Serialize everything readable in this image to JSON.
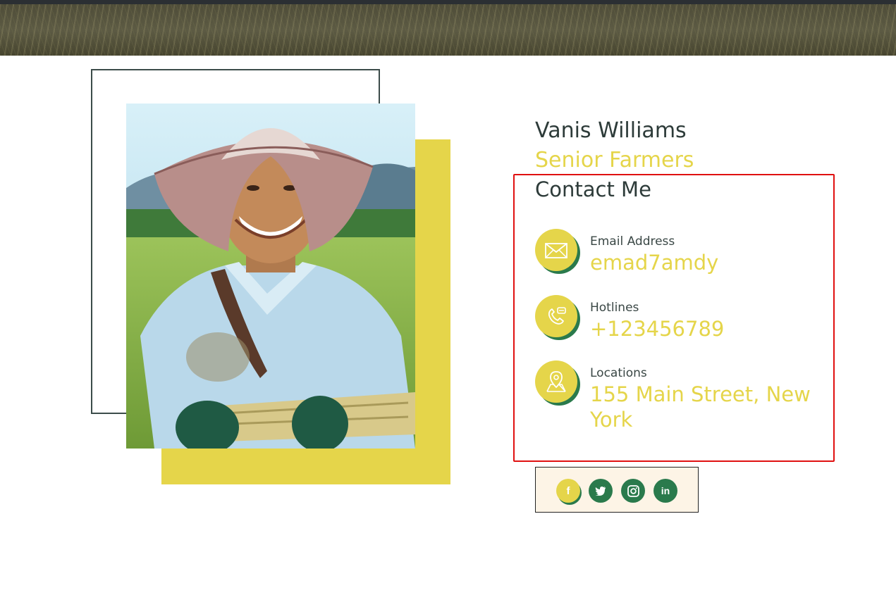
{
  "profile": {
    "name": "Vanis Williams",
    "role": "Senior Farmers"
  },
  "contact": {
    "title": "Contact Me",
    "items": [
      {
        "label": "Email Address",
        "value": "emad7amdy",
        "icon": "envelope-icon"
      },
      {
        "label": "Hotlines",
        "value": "+123456789",
        "icon": "phone-icon"
      },
      {
        "label": "Locations",
        "value": "155 Main Street, New York",
        "icon": "map-pin-icon"
      }
    ]
  },
  "social": [
    {
      "icon": "facebook-icon",
      "glyph": "f"
    },
    {
      "icon": "twitter-icon",
      "glyph": ""
    },
    {
      "icon": "instagram-icon",
      "glyph": ""
    },
    {
      "icon": "linkedin-icon",
      "glyph": "in"
    }
  ],
  "colors": {
    "accent": "#e5d54a",
    "brand_green": "#2a7a4c",
    "text_dark": "#2d3b39",
    "highlight_box": "#e01010"
  }
}
